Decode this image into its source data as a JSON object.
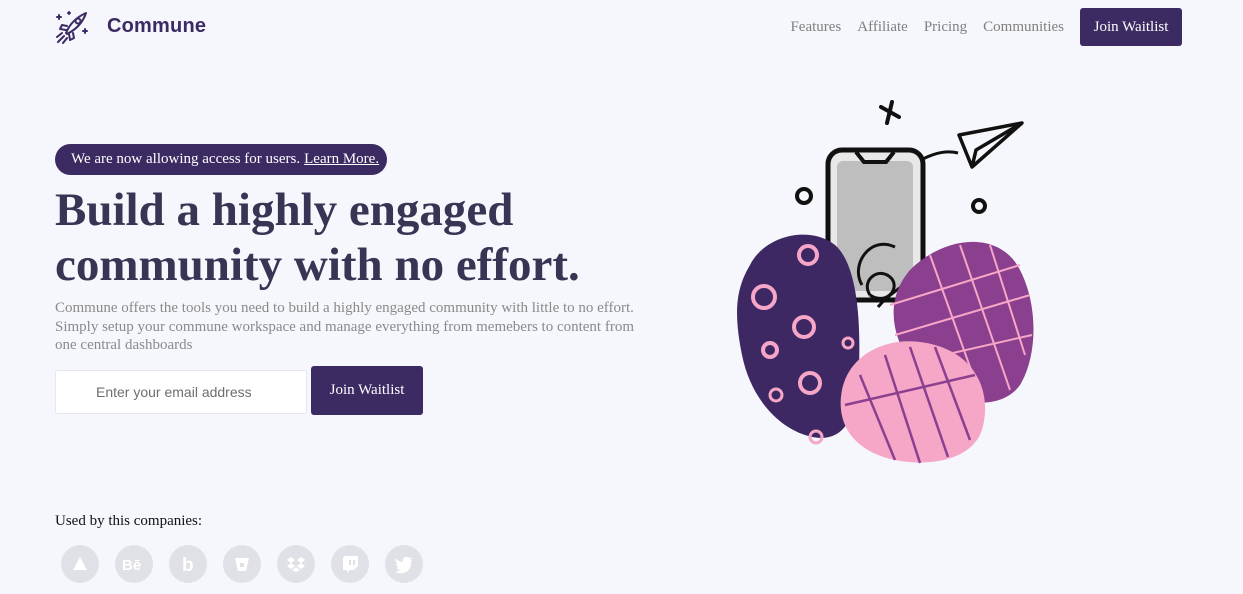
{
  "brand": {
    "name": "Commune"
  },
  "nav": {
    "links": [
      "Features",
      "Affiliate",
      "Pricing",
      "Communities"
    ],
    "cta": "Join Waitlist"
  },
  "hero": {
    "announcement": "We are now allowing access for users.",
    "announcement_link": "Learn More.",
    "headline_line1": "Build a highly engaged",
    "headline_line2": "community with no effort.",
    "description": "Commune offers the tools you need to build a highly engaged community with little to no effort. Simply setup your commune workspace and manage everything from memebers to content from one central dashboards",
    "email_placeholder": "Enter your email address",
    "cta": "Join Waitlist"
  },
  "companies": {
    "label": "Used by this companies:",
    "icons": [
      "artstation-icon",
      "behance-icon",
      "bing-icon",
      "bitbucket-icon",
      "dropbox-icon",
      "twitch-icon",
      "twitter-icon"
    ]
  },
  "colors": {
    "brand": "#3c2a63",
    "background": "#f5f7fc",
    "heading": "#363553",
    "pink": "#f6a6c6",
    "purple": "#8b3f8f"
  }
}
